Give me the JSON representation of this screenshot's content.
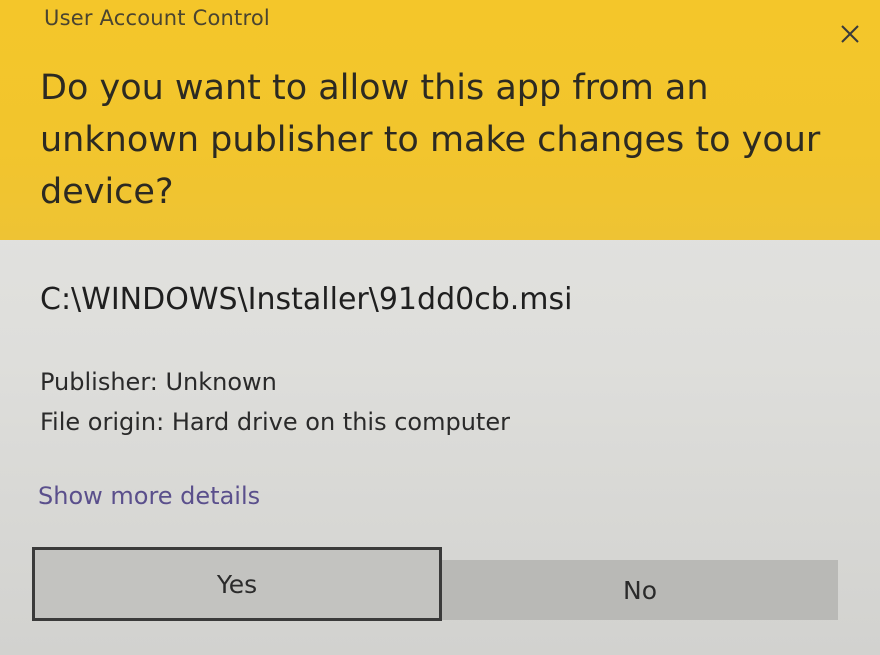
{
  "window": {
    "title": "User Account Control",
    "close_icon": "close-icon"
  },
  "header": {
    "question": "Do you want to allow this app from an unknown publisher to make changes to your device?",
    "background_color": "#f2c52d"
  },
  "app": {
    "path": "C:\\WINDOWS\\Installer\\91dd0cb.msi",
    "publisher": "Publisher: Unknown",
    "file_origin": "File origin: Hard drive on this computer"
  },
  "details_link": "Show more details",
  "buttons": {
    "yes_label": "Yes",
    "no_label": "No"
  }
}
